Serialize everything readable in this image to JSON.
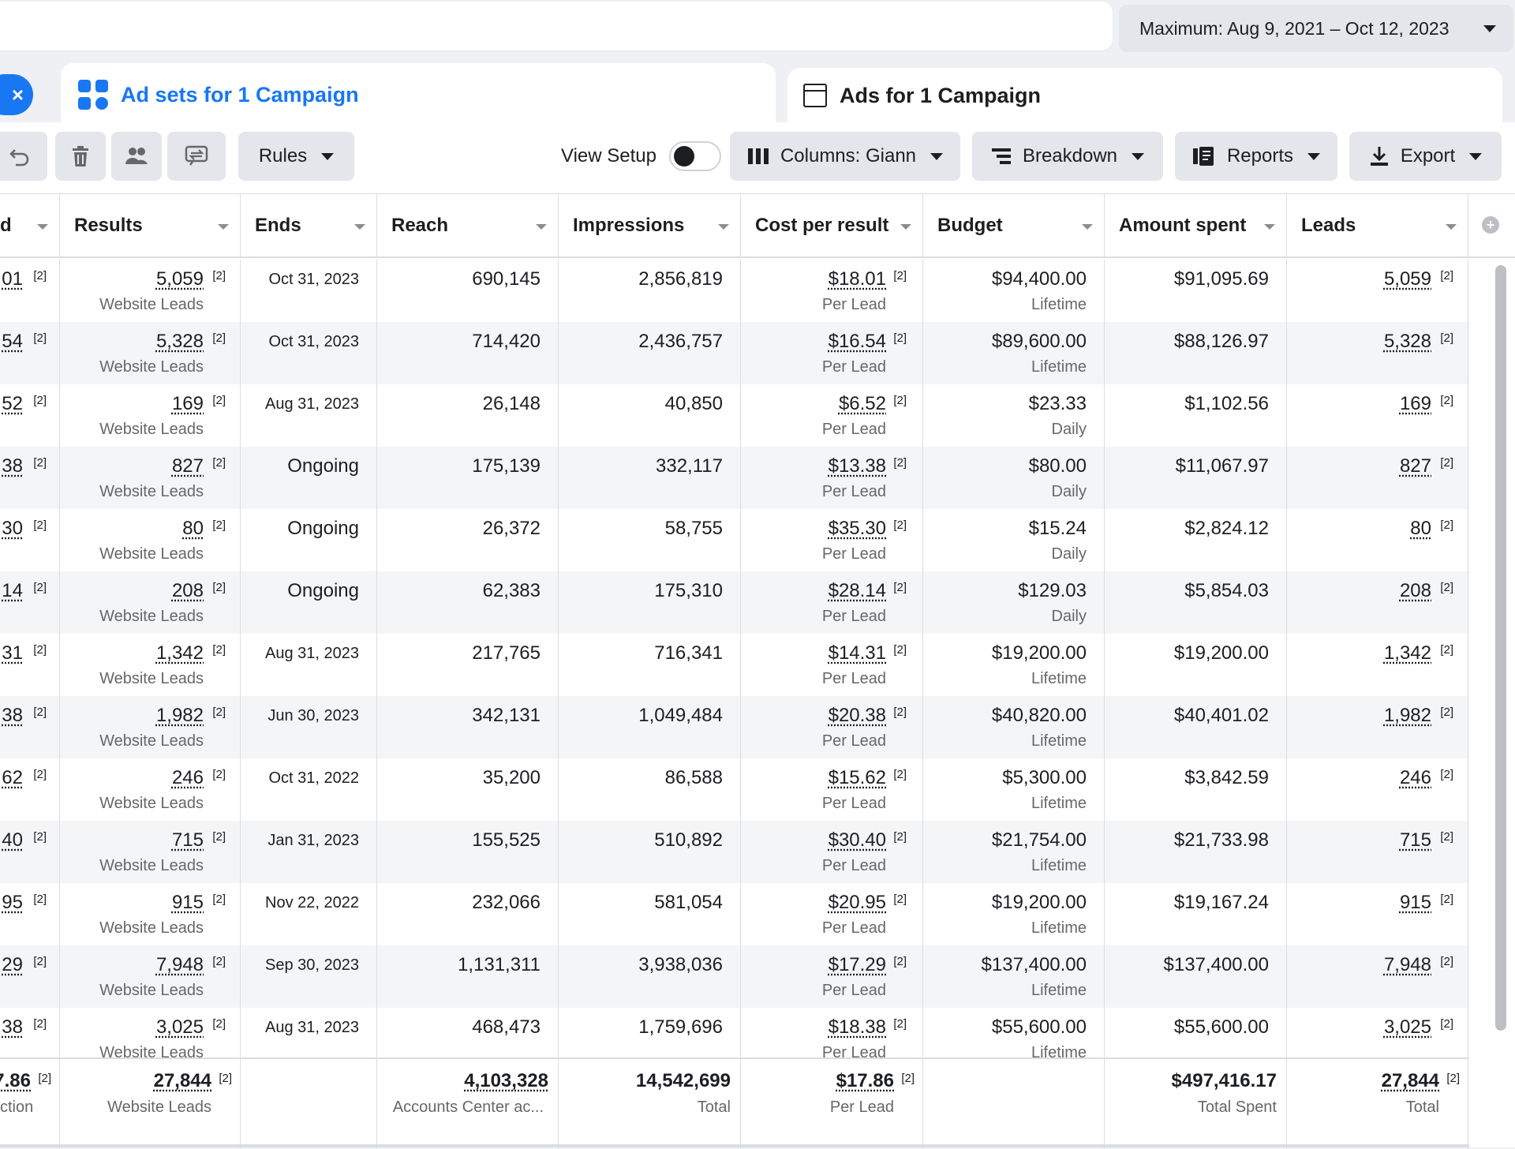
{
  "date_range": "Maximum: Aug 9, 2021 – Oct 12, 2023",
  "close_label": "×",
  "tabs": [
    {
      "label": "Ad sets for 1 Campaign",
      "active": true
    },
    {
      "label": "Ads for 1 Campaign",
      "active": false
    }
  ],
  "toolbar": {
    "icon_buttons": [
      "undo-icon",
      "trash-icon",
      "people-icon",
      "compare-icon"
    ],
    "rules": "Rules",
    "view_setup": "View Setup",
    "columns": "Columns: Giann",
    "breakdown": "Breakdown",
    "reports": "Reports",
    "export": "Export"
  },
  "columns": [
    "d",
    "Results",
    "Ends",
    "Reach",
    "Impressions",
    "Cost per result",
    "Budget",
    "Amount spent",
    "Leads"
  ],
  "footnote": "[2]",
  "rows": [
    {
      "cpl": "01",
      "results": "5,059",
      "results_sub": "Website Leads",
      "ends": "Oct 31, 2023",
      "reach": "690,145",
      "impressions": "2,856,819",
      "cpr": "$18.01",
      "cpr_sub": "Per Lead",
      "budget": "$94,400.00",
      "budget_sub": "Lifetime",
      "spent": "$91,095.69",
      "leads": "5,059"
    },
    {
      "cpl": "54",
      "results": "5,328",
      "results_sub": "Website Leads",
      "ends": "Oct 31, 2023",
      "reach": "714,420",
      "impressions": "2,436,757",
      "cpr": "$16.54",
      "cpr_sub": "Per Lead",
      "budget": "$89,600.00",
      "budget_sub": "Lifetime",
      "spent": "$88,126.97",
      "leads": "5,328"
    },
    {
      "cpl": "52",
      "results": "169",
      "results_sub": "Website Leads",
      "ends": "Aug 31, 2023",
      "reach": "26,148",
      "impressions": "40,850",
      "cpr": "$6.52",
      "cpr_sub": "Per Lead",
      "budget": "$23.33",
      "budget_sub": "Daily",
      "spent": "$1,102.56",
      "leads": "169"
    },
    {
      "cpl": "38",
      "results": "827",
      "results_sub": "Website Leads",
      "ends": "Ongoing",
      "reach": "175,139",
      "impressions": "332,117",
      "cpr": "$13.38",
      "cpr_sub": "Per Lead",
      "budget": "$80.00",
      "budget_sub": "Daily",
      "spent": "$11,067.97",
      "leads": "827"
    },
    {
      "cpl": "30",
      "results": "80",
      "results_sub": "Website Leads",
      "ends": "Ongoing",
      "reach": "26,372",
      "impressions": "58,755",
      "cpr": "$35.30",
      "cpr_sub": "Per Lead",
      "budget": "$15.24",
      "budget_sub": "Daily",
      "spent": "$2,824.12",
      "leads": "80"
    },
    {
      "cpl": "14",
      "results": "208",
      "results_sub": "Website Leads",
      "ends": "Ongoing",
      "reach": "62,383",
      "impressions": "175,310",
      "cpr": "$28.14",
      "cpr_sub": "Per Lead",
      "budget": "$129.03",
      "budget_sub": "Daily",
      "spent": "$5,854.03",
      "leads": "208"
    },
    {
      "cpl": "31",
      "results": "1,342",
      "results_sub": "Website Leads",
      "ends": "Aug 31, 2023",
      "reach": "217,765",
      "impressions": "716,341",
      "cpr": "$14.31",
      "cpr_sub": "Per Lead",
      "budget": "$19,200.00",
      "budget_sub": "Lifetime",
      "spent": "$19,200.00",
      "leads": "1,342"
    },
    {
      "cpl": "38",
      "results": "1,982",
      "results_sub": "Website Leads",
      "ends": "Jun 30, 2023",
      "reach": "342,131",
      "impressions": "1,049,484",
      "cpr": "$20.38",
      "cpr_sub": "Per Lead",
      "budget": "$40,820.00",
      "budget_sub": "Lifetime",
      "spent": "$40,401.02",
      "leads": "1,982"
    },
    {
      "cpl": "62",
      "results": "246",
      "results_sub": "Website Leads",
      "ends": "Oct 31, 2022",
      "reach": "35,200",
      "impressions": "86,588",
      "cpr": "$15.62",
      "cpr_sub": "Per Lead",
      "budget": "$5,300.00",
      "budget_sub": "Lifetime",
      "spent": "$3,842.59",
      "leads": "246"
    },
    {
      "cpl": "40",
      "results": "715",
      "results_sub": "Website Leads",
      "ends": "Jan 31, 2023",
      "reach": "155,525",
      "impressions": "510,892",
      "cpr": "$30.40",
      "cpr_sub": "Per Lead",
      "budget": "$21,754.00",
      "budget_sub": "Lifetime",
      "spent": "$21,733.98",
      "leads": "715"
    },
    {
      "cpl": "95",
      "results": "915",
      "results_sub": "Website Leads",
      "ends": "Nov 22, 2022",
      "reach": "232,066",
      "impressions": "581,054",
      "cpr": "$20.95",
      "cpr_sub": "Per Lead",
      "budget": "$19,200.00",
      "budget_sub": "Lifetime",
      "spent": "$19,167.24",
      "leads": "915"
    },
    {
      "cpl": "29",
      "results": "7,948",
      "results_sub": "Website Leads",
      "ends": "Sep 30, 2023",
      "reach": "1,131,311",
      "impressions": "3,938,036",
      "cpr": "$17.29",
      "cpr_sub": "Per Lead",
      "budget": "$137,400.00",
      "budget_sub": "Lifetime",
      "spent": "$137,400.00",
      "leads": "7,948"
    },
    {
      "cpl": "38",
      "results": "3,025",
      "results_sub": "Website Leads",
      "ends": "Aug 31, 2023",
      "reach": "468,473",
      "impressions": "1,759,696",
      "cpr": "$18.38",
      "cpr_sub": "Per Lead",
      "budget": "$55,600.00",
      "budget_sub": "Lifetime",
      "spent": "$55,600.00",
      "leads": "3,025"
    }
  ],
  "totals": {
    "cpl": "7.86",
    "cpl_sub": "ction",
    "results": "27,844",
    "results_sub": "Website Leads",
    "reach": "4,103,328",
    "reach_sub": "Accounts Center ac...",
    "impressions": "14,542,699",
    "impressions_sub": "Total",
    "cpr": "$17.86",
    "cpr_sub": "Per Lead",
    "spent": "$497,416.17",
    "spent_sub": "Total Spent",
    "leads": "27,844",
    "leads_sub": "Total"
  },
  "colors": {
    "accent": "#1877f2",
    "text": "#1c1e21",
    "muted": "#65676b",
    "stripe": "#f4f5f7"
  }
}
